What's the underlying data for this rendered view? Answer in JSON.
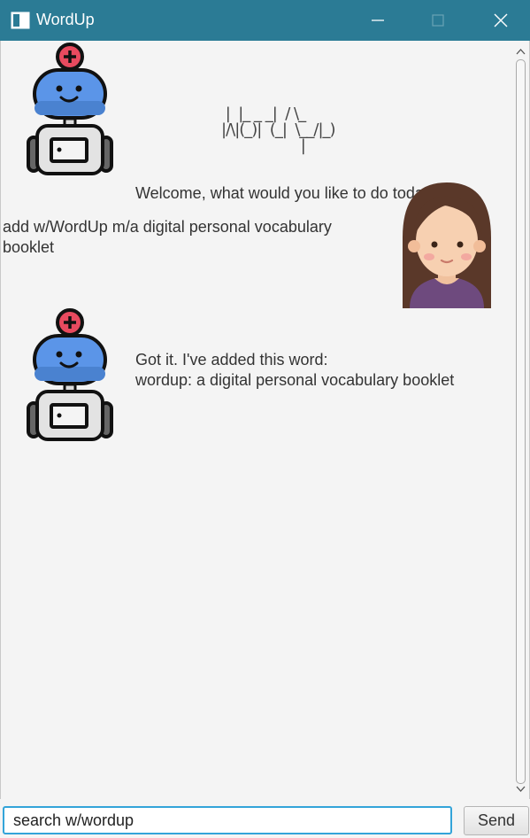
{
  "window": {
    "title": "WordUp",
    "icon": "window-app-icon",
    "controls": [
      "minimize-icon",
      "maximize-icon",
      "close-icon"
    ]
  },
  "chat": {
    "banner": [
      " |  |_ _ _|  / \\_",
      "|/\\|(_)|  (_|  \\__/|_)",
      "                   |"
    ],
    "messages": [
      {
        "from": "bot",
        "avatar": "robot-icon",
        "text": "Welcome, what would you like to do today?"
      },
      {
        "from": "user",
        "avatar": "woman-avatar",
        "text": "add w/WordUp m/a digital personal vocabulary booklet"
      },
      {
        "from": "bot",
        "avatar": "robot-icon",
        "lines": [
          "Got it. I've added this word:",
          "wordup: a digital personal vocabulary booklet"
        ]
      }
    ]
  },
  "input": {
    "value": "search w/wordup",
    "send_label": "Send"
  },
  "colors": {
    "titlebar": "#2b7b95",
    "background": "#f4f4f4",
    "input_focus": "#33a4d9"
  }
}
